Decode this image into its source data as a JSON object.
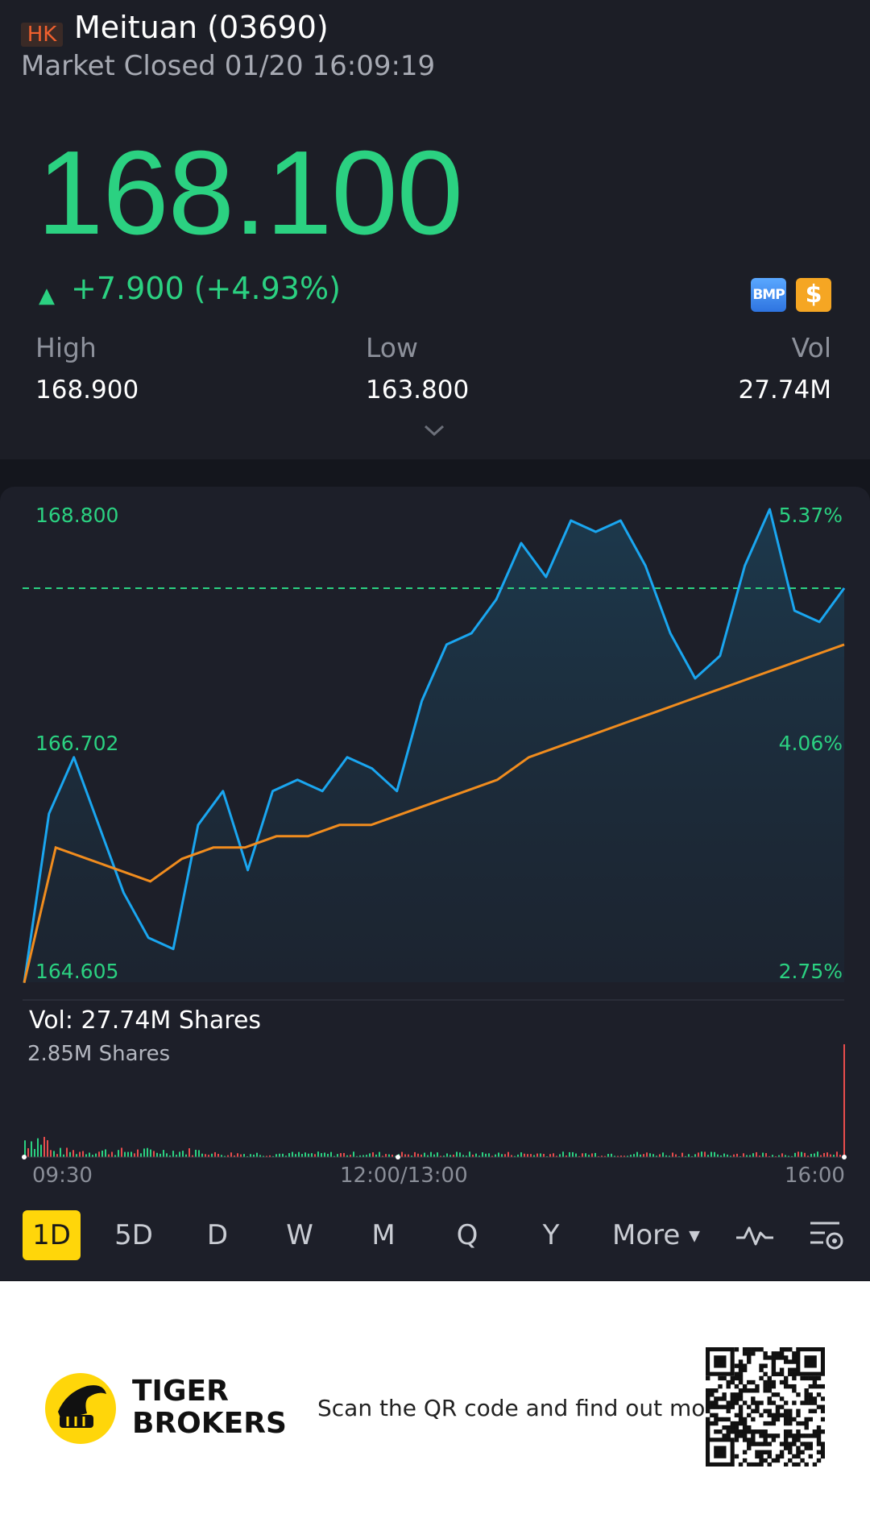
{
  "header": {
    "market_badge": "HK",
    "title": "Meituan (03690)",
    "status": "Market Closed 01/20 16:09:19"
  },
  "quote": {
    "price": "168.100",
    "change_arrow": "▲",
    "change": "+7.900 (+4.93%)",
    "badges": [
      "BMP",
      "$"
    ],
    "stats": [
      {
        "label": "High",
        "value": "168.900"
      },
      {
        "label": "Low",
        "value": "163.800"
      },
      {
        "label": "Vol",
        "value": "27.74M"
      }
    ]
  },
  "chart": {
    "y_left": [
      "168.800",
      "166.702",
      "164.605"
    ],
    "y_right": [
      "5.37%",
      "4.06%",
      "2.75%"
    ],
    "volume_label": "Vol:   27.74M Shares",
    "volume_max_label": "2.85M Shares",
    "time_labels": [
      "09:30",
      "12:00/13:00",
      "16:00"
    ]
  },
  "timeframes": [
    "1D",
    "5D",
    "D",
    "W",
    "M",
    "Q",
    "Y"
  ],
  "more_label": "More",
  "footer": {
    "brand_line1": "TIGER",
    "brand_line2": "BROKERS",
    "scan_text": "Scan the QR code and find out more"
  },
  "icons": [
    "chevron-down-icon",
    "indicator-icon",
    "chart-settings-icon",
    "tiger-logo-icon",
    "qr-code"
  ],
  "colors": {
    "up": "#2bd181",
    "price_line": "#1aa6f0",
    "avg_line": "#f08c1e",
    "active_tab": "#ffd60a",
    "background": "#1c1e26"
  },
  "chart_data": {
    "type": "line",
    "x": [
      "09:30",
      "12:00/13:00",
      "16:00"
    ],
    "y_axis_ticks": [
      168.8,
      166.702,
      164.605
    ],
    "pct_axis_ticks": [
      "5.37%",
      "4.06%",
      "2.75%"
    ],
    "ylim": [
      164.605,
      168.8
    ],
    "reference_line": 168.1,
    "series": [
      {
        "values": [
          164.6,
          166.1,
          166.6,
          166.0,
          165.4,
          165.0,
          164.9,
          166.0,
          166.3,
          165.6,
          166.3,
          166.4,
          166.3,
          166.6,
          166.5,
          166.3,
          167.1,
          167.6,
          167.7,
          168.0,
          168.5,
          168.2,
          168.7,
          168.6,
          168.7,
          168.3,
          167.7,
          167.3,
          167.5,
          168.3,
          168.8,
          167.9,
          167.8,
          168.1
        ]
      },
      {
        "values": [
          164.6,
          165.8,
          165.7,
          165.6,
          165.5,
          165.7,
          165.8,
          165.8,
          165.9,
          165.9,
          166.0,
          166.0,
          166.1,
          166.2,
          166.3,
          166.4,
          166.6,
          166.7,
          166.8,
          166.9,
          167.0,
          167.1,
          167.2,
          167.3,
          167.4,
          167.5,
          167.6
        ]
      }
    ]
  }
}
